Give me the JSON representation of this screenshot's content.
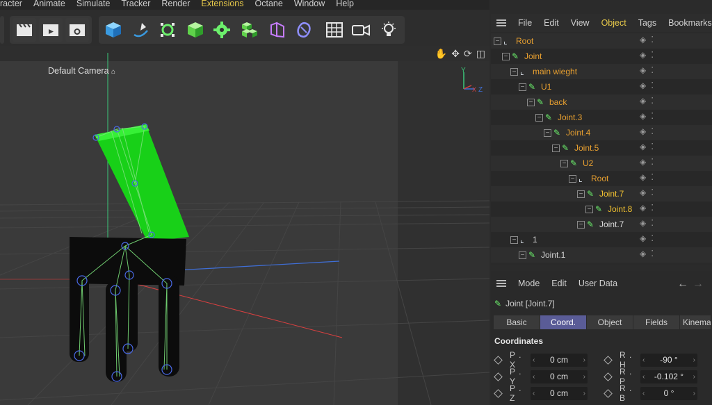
{
  "menubar": {
    "items": [
      "racter",
      "Animate",
      "Simulate",
      "Tracker",
      "Render",
      "Extensions",
      "Octane",
      "Window",
      "Help"
    ]
  },
  "viewport": {
    "camera_label": "Default Camera",
    "axis_labels": {
      "y": "Y",
      "z": "Z",
      "x": "X"
    }
  },
  "object_manager": {
    "menu": [
      "File",
      "Edit",
      "View",
      "Object",
      "Tags",
      "Bookmarks"
    ],
    "active_menu": "Object",
    "rows": [
      {
        "label": "Root",
        "depth": 0,
        "type": "null",
        "color": "orange"
      },
      {
        "label": "Joint",
        "depth": 1,
        "type": "joint",
        "color": "orange"
      },
      {
        "label": "main wieght",
        "depth": 2,
        "type": "null",
        "color": "orange"
      },
      {
        "label": "U1",
        "depth": 3,
        "type": "joint",
        "color": "orange"
      },
      {
        "label": "back",
        "depth": 4,
        "type": "joint",
        "color": "orange"
      },
      {
        "label": "Joint.3",
        "depth": 5,
        "type": "joint",
        "color": "orange"
      },
      {
        "label": "Joint.4",
        "depth": 6,
        "type": "joint",
        "color": "orange"
      },
      {
        "label": "Joint.5",
        "depth": 7,
        "type": "joint",
        "color": "orange"
      },
      {
        "label": "U2",
        "depth": 8,
        "type": "joint",
        "color": "orange"
      },
      {
        "label": "Root",
        "depth": 9,
        "type": "null",
        "color": "orange"
      },
      {
        "label": "Joint.7",
        "depth": 10,
        "type": "joint",
        "color": "gold"
      },
      {
        "label": "Joint.8",
        "depth": 11,
        "type": "joint",
        "color": "gold"
      },
      {
        "label": "Joint.7",
        "depth": 10,
        "type": "joint",
        "color": "white"
      },
      {
        "label": "1",
        "depth": 2,
        "type": "null",
        "color": "white"
      },
      {
        "label": "Joint.1",
        "depth": 3,
        "type": "joint",
        "color": "white"
      }
    ]
  },
  "attribute_manager": {
    "menu": [
      "Mode",
      "Edit",
      "User Data"
    ],
    "title": "Joint [Joint.7]",
    "tabs": [
      "Basic",
      "Coord.",
      "Object",
      "Fields",
      "Kinemat"
    ],
    "selected_tab": "Coord.",
    "section": "Coordinates",
    "fields": [
      {
        "pos_label": "P . X",
        "pos_value": "0 cm",
        "rot_label": "R . H",
        "rot_value": "-90 °"
      },
      {
        "pos_label": "P . Y",
        "pos_value": "0 cm",
        "rot_label": "R . P",
        "rot_value": "-0.102 °"
      },
      {
        "pos_label": "P . Z",
        "pos_value": "0 cm",
        "rot_label": "R . B",
        "rot_value": "0 °"
      }
    ]
  },
  "colors": {
    "accent_tab": "#5a5c97",
    "active_menu": "#e6c84a",
    "joint_green": "#2ee82e"
  }
}
